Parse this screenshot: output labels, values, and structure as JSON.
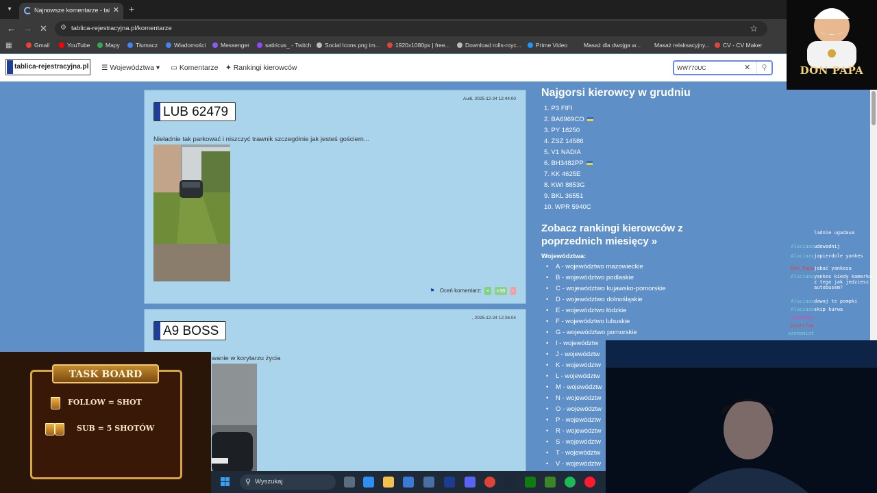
{
  "browser": {
    "tab_title": "Najnowsze komentarze - tablic...",
    "url": "tablica-rejestracyjna.pl/komentarze",
    "bookmarks": [
      "Gmail",
      "YouTube",
      "Mapy",
      "Tłumacz",
      "Wiadomości",
      "Messenger",
      "satiricus_ - Twitch",
      "Social Icons png im...",
      "1920x1080px | free...",
      "Download rolls-royc...",
      "Prime Video",
      "Masaż dla dwojga w...",
      "Masaż relaksacyjny...",
      "CV - CV Maker"
    ]
  },
  "site": {
    "logo": "tablica-rejestracyjna.pl",
    "nav": {
      "woj": "Województwa",
      "komentarze": "Komentarze",
      "rankingi": "Rankingi kierowców"
    },
    "search_value": "WW770UC"
  },
  "comments": [
    {
      "meta": "Audi, 2025-12-24 12:44:00",
      "plate": "LUB 62479",
      "text": "Nieładnie tak parkować i niszczyć trawnik szczególnie jak jesteś gościem...",
      "rate_label": "Oceń komentarz:",
      "plus": "+",
      "score": "+38",
      "minus": "-"
    },
    {
      "meta": ", 2025-12-24 12:26:04",
      "plate": "A9 BOSS",
      "text": "wanie w korytarzu życia"
    }
  ],
  "sidebar": {
    "title": "Najgorsi kierowcy w grudniu",
    "ranking": [
      {
        "label": "1. P3 FIFI",
        "ua": false
      },
      {
        "label": "2. BA6969CO",
        "ua": true
      },
      {
        "label": "3. PY 18250",
        "ua": false
      },
      {
        "label": "4. ZSZ 14586",
        "ua": false
      },
      {
        "label": "5. V1 NADIA",
        "ua": false
      },
      {
        "label": "6. BH3482PP",
        "ua": true
      },
      {
        "label": "7. KK 4625E",
        "ua": false
      },
      {
        "label": "8. KWI 8853G",
        "ua": false
      },
      {
        "label": "9. BKL 36551",
        "ua": false
      },
      {
        "label": "10. WPR 5940C",
        "ua": false
      }
    ],
    "prev_link": "Zobacz rankingi kierowców z poprzednich miesięcy »",
    "woj_label": "Województwa:",
    "woj": [
      "A - województwo mazowieckie",
      "B - województwo podlaskie",
      "C - województwo kujawsko-pomorskie",
      "D - województwo dolnośląskie",
      "E - województwo łódzkie",
      "F - województwo lubuskie",
      "G - województwo pomorskie",
      "I - województw",
      "J - województw",
      "K - województw",
      "L - województw",
      "M - województw",
      "N - województw",
      "O - województw",
      "P - województw",
      "R - województw",
      "S - województw",
      "T - województw",
      "V - województw"
    ]
  },
  "stream": {
    "brand": "DON PAPA",
    "task_title": "TASK BOARD",
    "task1": "FOLLOW = SHOT",
    "task2": "SUB = 5 SHOTÓW",
    "chat": [
      {
        "user": "",
        "msg": "ladnie ugadaua",
        "color": "#7fd4d4"
      },
      {
        "user": "Aluciaax",
        "msg": "udowodnij",
        "color": "#7fd4d4"
      },
      {
        "user": "Aluciaax",
        "msg": "japierdole yankes",
        "color": "#7fd4d4"
      },
      {
        "user": "DOn_Papa",
        "msg": "jebać yankesa",
        "color": "#e2433c"
      },
      {
        "user": "Aluciaax",
        "msg": "yankes kiedy kamerka z tego jak jedziesz autobusem?",
        "color": "#7fd4d4"
      },
      {
        "user": "Aluciaax",
        "msg": "dawaj te pompki",
        "color": "#7fd4d4"
      },
      {
        "user": "Aluciaax",
        "msg": "skip kurwa",
        "color": "#7fd4d4"
      },
      {
        "user": "sigmakoz",
        "msg": "",
        "color": "#e24aa0"
      },
      {
        "user": "kontrfan",
        "msg": "",
        "color": "#e2433c"
      },
      {
        "user": "szonomiot",
        "msg": "",
        "color": "#7fd4d4"
      }
    ]
  },
  "taskbar": {
    "search": "Wyszukaj"
  }
}
